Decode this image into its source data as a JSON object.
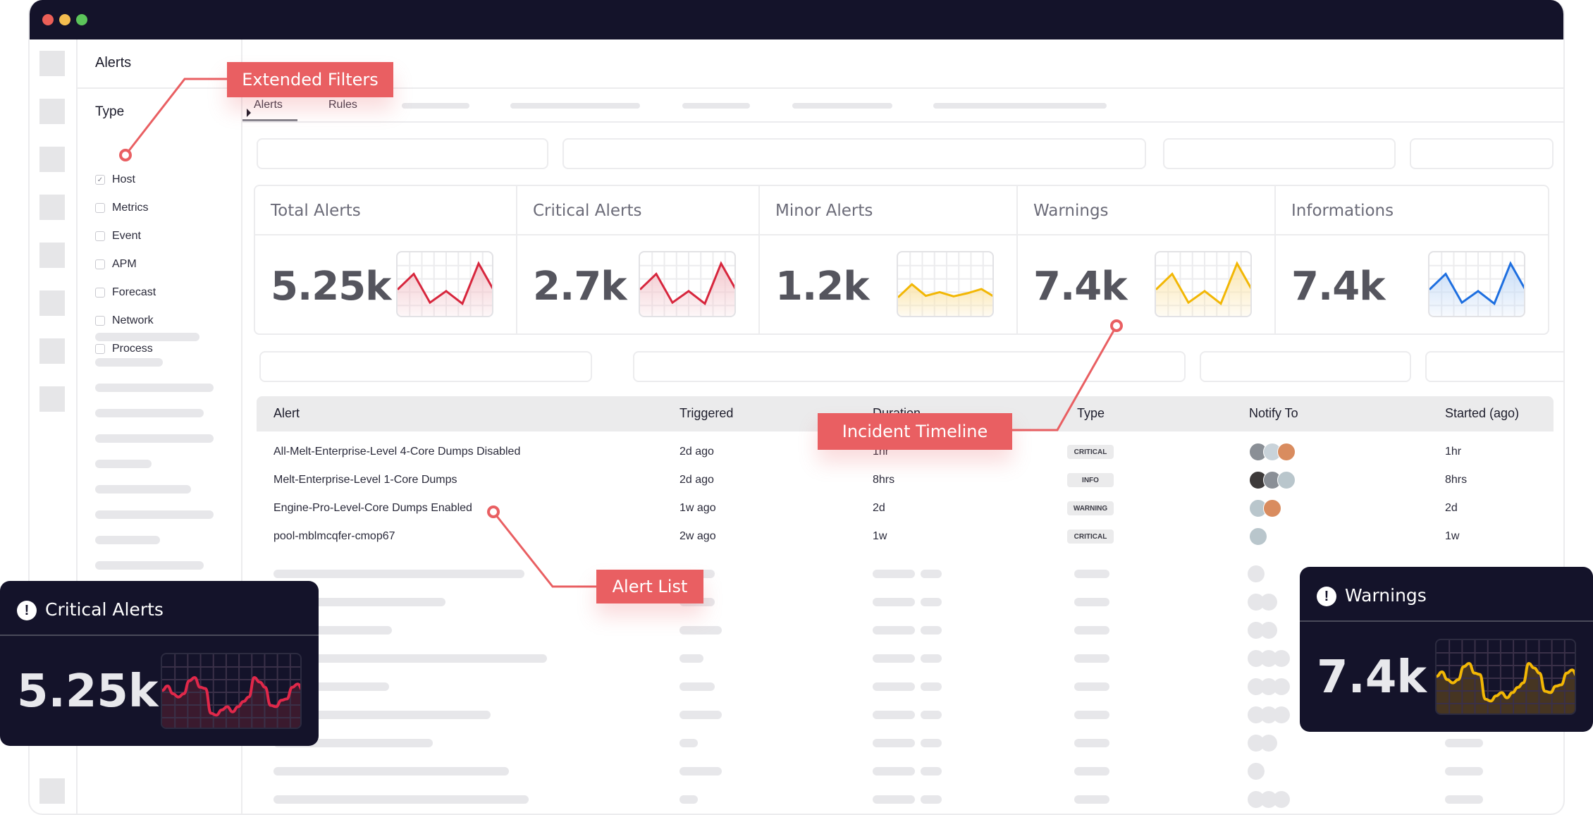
{
  "window": {
    "controls": [
      "close",
      "minimize",
      "maximize"
    ]
  },
  "sidebar_title": "Alerts",
  "filters": {
    "group_label": "Type",
    "items": [
      {
        "label": "Host",
        "checked": true
      },
      {
        "label": "Metrics",
        "checked": false
      },
      {
        "label": "Event",
        "checked": false
      },
      {
        "label": "APM",
        "checked": false
      },
      {
        "label": "Forecast",
        "checked": false
      },
      {
        "label": "Network",
        "checked": false
      },
      {
        "label": "Process",
        "checked": false
      }
    ]
  },
  "tabs": [
    {
      "label": "Alerts",
      "active": true
    },
    {
      "label": "Rules",
      "active": false
    }
  ],
  "stats": [
    {
      "title": "Total Alerts",
      "value": "5.25k",
      "color": "#d7263d",
      "fill": "#f3c6cc",
      "series": [
        0.45,
        0.75,
        0.2,
        0.42,
        0.18,
        0.95,
        0.4
      ]
    },
    {
      "title": "Critical Alerts",
      "value": "2.7k",
      "color": "#d7263d",
      "fill": "#f3c6cc",
      "series": [
        0.45,
        0.75,
        0.2,
        0.42,
        0.18,
        0.95,
        0.4
      ]
    },
    {
      "title": "Minor Alerts",
      "value": "1.2k",
      "color": "#f2b705",
      "fill": "#fbe6b0",
      "series": [
        0.3,
        0.55,
        0.33,
        0.4,
        0.32,
        0.38,
        0.46,
        0.3
      ]
    },
    {
      "title": "Warnings",
      "value": "7.4k",
      "color": "#f2b705",
      "fill": "#fbe6b0",
      "series": [
        0.45,
        0.75,
        0.2,
        0.42,
        0.18,
        0.95,
        0.4
      ]
    },
    {
      "title": "Informations",
      "value": "7.4k",
      "color": "#1e6fe0",
      "fill": "#c7dcf7",
      "series": [
        0.45,
        0.75,
        0.2,
        0.42,
        0.18,
        0.95,
        0.4
      ]
    }
  ],
  "table": {
    "headers": [
      "Alert",
      "Triggered",
      "Duration",
      "Type",
      "Notify To",
      "Started (ago)"
    ],
    "rows": [
      {
        "alert": "All-Melt-Enterprise-Level 4-Core Dumps Disabled",
        "triggered": "2d ago",
        "duration": "1hr",
        "type": "CRITICAL",
        "notify_count": 3,
        "started": "1hr"
      },
      {
        "alert": "Melt-Enterprise-Level 1-Core Dumps",
        "triggered": "2d ago",
        "duration": "8hrs",
        "type": "INFO",
        "notify_count": 3,
        "started": "8hrs"
      },
      {
        "alert": "Engine-Pro-Level-Core Dumps Enabled",
        "triggered": "1w ago",
        "duration": "2d",
        "type": "WARNING",
        "notify_count": 2,
        "started": "2d"
      },
      {
        "alert": "pool-mblmcqfer-cmop67",
        "triggered": "2w ago",
        "duration": "1w",
        "type": "CRITICAL",
        "notify_count": 1,
        "started": "1w"
      }
    ]
  },
  "callouts": {
    "extended_filters": "Extended Filters",
    "incident_timeline": "Incident Timeline",
    "alert_list": "Alert List"
  },
  "floating_cards": [
    {
      "title": "Critical Alerts",
      "value": "5.25k",
      "icon": "exclamation-icon",
      "color": "#e0284a",
      "fill": "#3a1a2e",
      "grid": "#3a3048",
      "series": [
        0.55,
        0.62,
        0.5,
        0.45,
        0.5,
        0.7,
        0.75,
        0.6,
        0.58,
        0.2,
        0.17,
        0.25,
        0.3,
        0.22,
        0.3,
        0.38,
        0.45,
        0.75,
        0.68,
        0.6,
        0.32,
        0.3,
        0.4,
        0.42,
        0.6,
        0.65,
        0.55
      ]
    },
    {
      "title": "Warnings",
      "value": "7.4k",
      "icon": "exclamation-icon",
      "color": "#f2b705",
      "fill": "#463522",
      "grid": "#3a3048",
      "series": [
        0.55,
        0.62,
        0.5,
        0.45,
        0.5,
        0.7,
        0.75,
        0.6,
        0.58,
        0.2,
        0.17,
        0.25,
        0.3,
        0.22,
        0.3,
        0.38,
        0.45,
        0.75,
        0.68,
        0.6,
        0.32,
        0.3,
        0.4,
        0.42,
        0.6,
        0.65,
        0.55
      ]
    }
  ]
}
